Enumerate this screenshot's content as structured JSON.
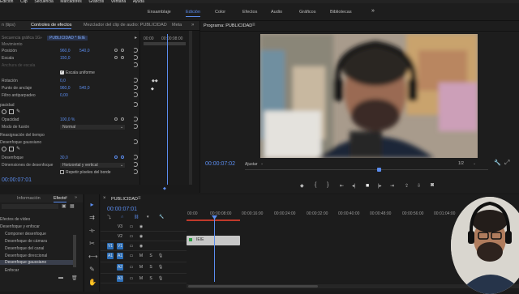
{
  "menu": [
    "Edición",
    "Clip",
    "Secuencia",
    "Marcadores",
    "Gráficos",
    "Ventana",
    "Ayuda"
  ],
  "workspaces": [
    {
      "label": "Ensamblaje",
      "active": false
    },
    {
      "label": "Edición",
      "active": true
    },
    {
      "label": "Color",
      "active": false
    },
    {
      "label": "Efectos",
      "active": false
    },
    {
      "label": "Audio",
      "active": false
    },
    {
      "label": "Gráficos",
      "active": false
    },
    {
      "label": "Bibliotecas",
      "active": false
    }
  ],
  "workspace_more": "»",
  "left_tabs": {
    "tab0": "n (tips)",
    "effect_controls": "Controles de efectos",
    "audio_mixer": "Mezclador del clip de audio: PUBLICIDAD",
    "meta": "Meta",
    "chevron": "»"
  },
  "effect_controls": {
    "master": "Secuencia gráfica 1G",
    "clip": "PUBLICIDAD * IEIE",
    "movement": "Movimiento",
    "rows": [
      {
        "label": "Posición",
        "v1": "960,0",
        "v2": "540,0"
      },
      {
        "label": "Escala",
        "v1": "150,0"
      },
      {
        "label": "Anchura de escala",
        "v1": ""
      },
      {
        "label": "Escala uniforme",
        "checkbox": true
      },
      {
        "label": "Rotación",
        "v1": "0,0"
      },
      {
        "label": "Punto de anclaje",
        "v1": "960,0",
        "v2": "540,0"
      },
      {
        "label": "Filtro antiparpadeo",
        "v1": "0,00"
      },
      {
        "label": "pacidad"
      },
      {
        "label": "Opacidad",
        "v1": "100,0 %"
      },
      {
        "label": "Modo de fusión",
        "v1": "Normal"
      },
      {
        "label": "Reasignación del tiempo"
      },
      {
        "label": "Desenfoque gaussiano"
      },
      {
        "label": "Desenfoque",
        "v1": "30,0"
      },
      {
        "label": "Dimensiones de desenfoque",
        "v1": "Horizontal y vertical"
      },
      {
        "label": "Repetir píxeles del borde",
        "checkbox": true
      }
    ],
    "tl_time1": "00:00",
    "tl_time2": "00:00:08:00",
    "timecode": "00:00:07:01"
  },
  "program": {
    "title": "Programa: PUBLICIDAD",
    "timecode": "00:00:07:02",
    "fit": "Ajustar",
    "resolution": "1/2"
  },
  "project": {
    "tab0": "",
    "info": "Información",
    "effects": "Efecto",
    "items": [
      "Efectos de vídeo",
      "Desenfoque y enfocar",
      "Componer desenfoque",
      "Desenfoque de cámara",
      "Desenfoque del canal",
      "Desenfoque direccional",
      "Desenfoque gaussiano",
      "Enfocar"
    ]
  },
  "timeline": {
    "seq_name": "PUBLICIDAD",
    "timecode": "00:00:07:01",
    "ruler": [
      "00:00",
      "00:00:08:00",
      "00:00:16:00",
      "00:00:24:00",
      "00:00:32:00",
      "00:00:40:00",
      "00:00:48:00",
      "00:00:56:00",
      "00:01:04:00"
    ],
    "tracks": [
      {
        "name": "V3",
        "kind": "video"
      },
      {
        "name": "V2",
        "kind": "video"
      },
      {
        "name": "V1",
        "kind": "video"
      },
      {
        "name": "A1",
        "kind": "audio"
      },
      {
        "name": "A2",
        "kind": "audio"
      },
      {
        "name": "A3",
        "kind": "audio"
      }
    ],
    "clip_label": "IEIE",
    "playhead_fraction": 0.11
  },
  "colors": {
    "accent": "#5b8def",
    "playhead": "#5b8def",
    "clip": "#c7c7c7",
    "track_btn": "#2d6fb8"
  }
}
